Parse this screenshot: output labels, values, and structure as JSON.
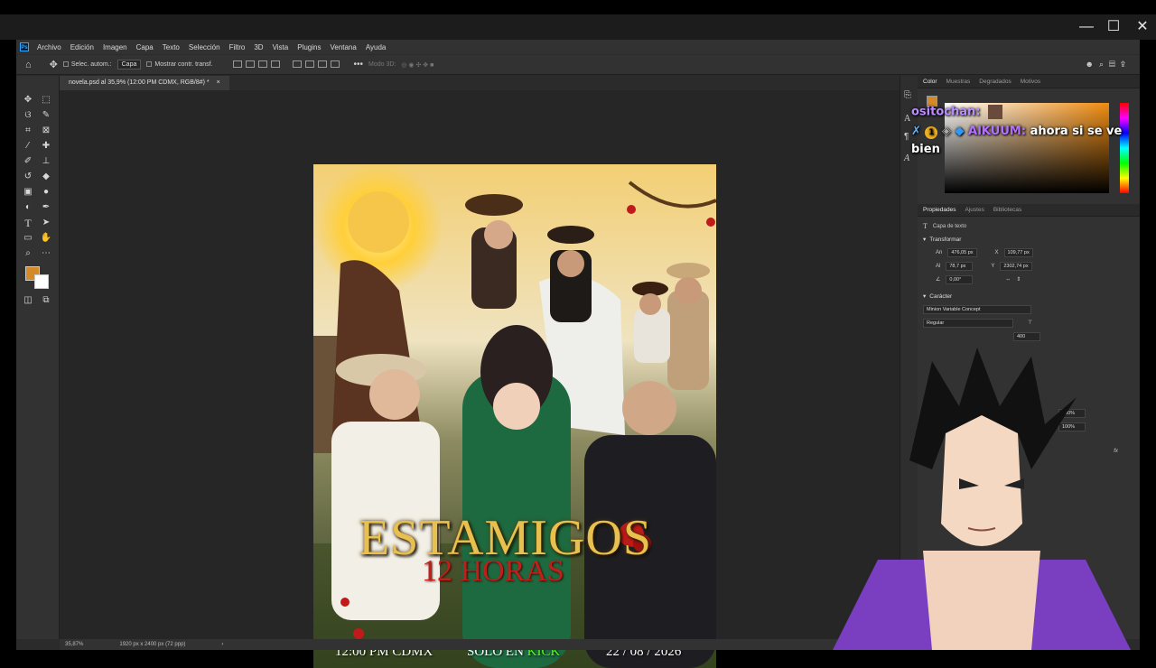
{
  "window": {
    "minimize": "—",
    "maximize": "☐",
    "close": "✕"
  },
  "menu": [
    "Archivo",
    "Edición",
    "Imagen",
    "Capa",
    "Texto",
    "Selección",
    "Filtro",
    "3D",
    "Vista",
    "Plugins",
    "Ventana",
    "Ayuda"
  ],
  "options": {
    "auto_select": "Selec. autom.:",
    "layer_dropdown": "Capa",
    "show_transform": "Mostrar contr. transf.",
    "mode_3d": "Modo 3D:"
  },
  "document_tab": "novela.psd al 35,9% (12:00 PM CDMX, RGB/8#) *",
  "status": {
    "zoom": "35,87%",
    "doc_info": "1920 px x 2400 px (72 ppp)"
  },
  "color_panel": {
    "tabs": [
      "Color",
      "Muestras",
      "Degradados",
      "Motivos"
    ],
    "foreground": "#d4892a",
    "background": "#ffffff"
  },
  "properties": {
    "tabs": [
      "Propiedades",
      "Ajustes",
      "Bibliotecas"
    ],
    "layer_type": "Capa de texto",
    "transform_title": "Transformar",
    "w_label": "An",
    "w": "476,05 px",
    "h_label": "Al",
    "h": "78,7 px",
    "x_label": "X",
    "x": "109,77 px",
    "y_label": "Y",
    "y": "2302,74 px",
    "angle": "0,00°",
    "character_title": "Carácter",
    "font": "Minion Variable Concept",
    "style": "Regular",
    "tracking": "400",
    "opacity_1": "100%",
    "opacity_2": "100%"
  },
  "poster": {
    "title": "ESTAMIGOS",
    "subtitle": "12 HORAS",
    "time": "12:00 PM CDMX",
    "solo_prefix": "SOLO EN ",
    "kick": "KICK",
    "date": "22 / 08 / 2026"
  },
  "chat": {
    "user1": "ositochan:",
    "user2": "AIKUUM:",
    "message": "ahora si se ve",
    "message2": "bien"
  }
}
